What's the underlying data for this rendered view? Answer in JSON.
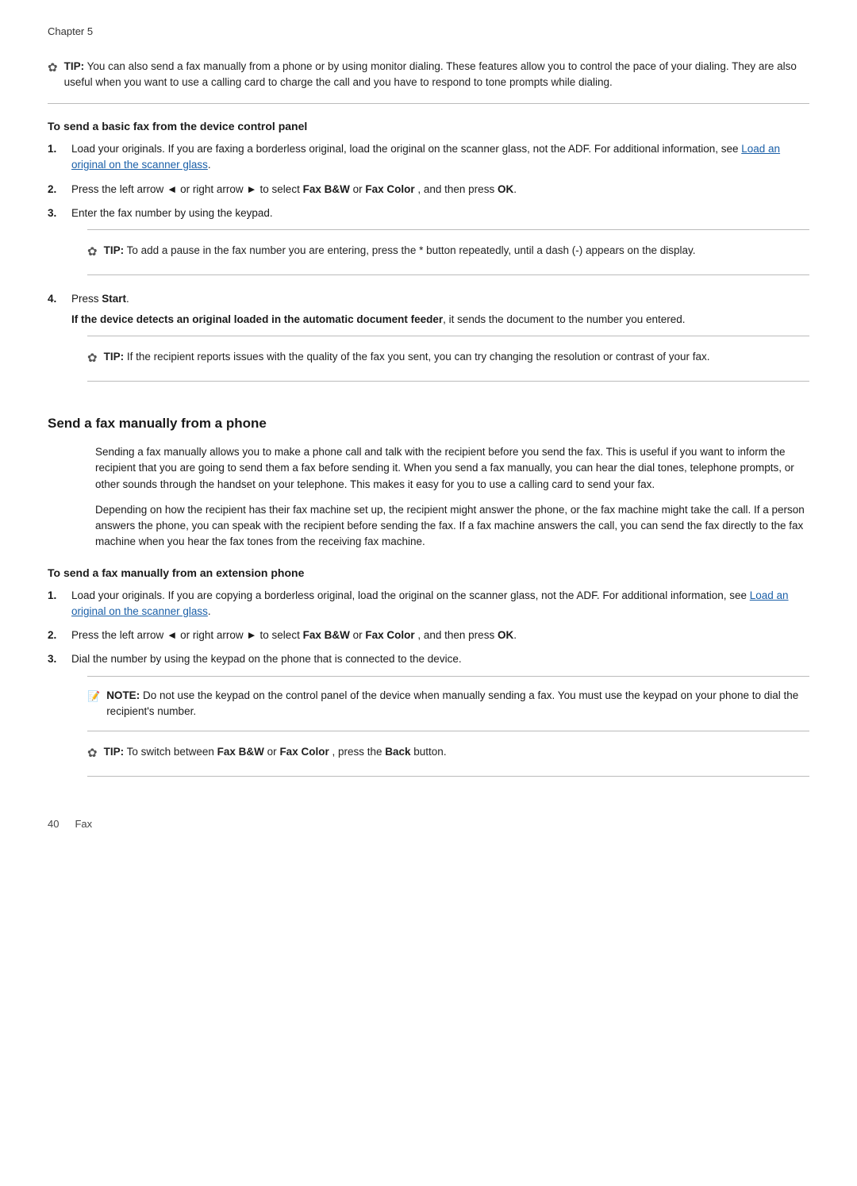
{
  "chapter": "Chapter 5",
  "footer": {
    "page_num": "40",
    "section": "Fax"
  },
  "tip1": {
    "label": "TIP:",
    "text": "You can also send a fax manually from a phone or by using monitor dialing. These features allow you to control the pace of your dialing. They are also useful when you want to use a calling card to charge the call and you have to respond to tone prompts while dialing."
  },
  "section1_heading": "To send a basic fax from the device control panel",
  "steps1": [
    {
      "num": "1.",
      "text_before": "Load your originals. If you are faxing a borderless original, load the original on the scanner glass, not the ADF. For additional information, see ",
      "link_text": "Load an original on the scanner glass",
      "text_after": ".",
      "link": true
    },
    {
      "num": "2.",
      "text_plain": "Press the left arrow ◄ or right arrow ► to select ",
      "bold1": "Fax B&W",
      "text_mid": " or ",
      "bold2": "Fax Color",
      "text_end": " , and then press ",
      "bold3": "OK",
      "text_final": ".",
      "has_bold": true,
      "link": false
    },
    {
      "num": "3.",
      "text_plain": "Enter the fax number by using the keypad.",
      "link": false
    }
  ],
  "tip2": {
    "label": "TIP:",
    "text": "To add a pause in the fax number you are entering, press the * button repeatedly, until a dash (-) appears on the display."
  },
  "step4": {
    "num": "4.",
    "bold_start": "Press ",
    "bold_word": "Start",
    "sub_bold": "If the device detects an original loaded in the automatic document feeder",
    "sub_text": ", it sends the document to the number you entered."
  },
  "tip3": {
    "label": "TIP:",
    "text": "If the recipient reports issues with the quality of the fax you sent, you can try changing the resolution or contrast of your fax."
  },
  "main_section_title": "Send a fax manually from a phone",
  "body_para1": "Sending a fax manually allows you to make a phone call and talk with the recipient before you send the fax. This is useful if you want to inform the recipient that you are going to send them a fax before sending it. When you send a fax manually, you can hear the dial tones, telephone prompts, or other sounds through the handset on your telephone. This makes it easy for you to use a calling card to send your fax.",
  "body_para2": "Depending on how the recipient has their fax machine set up, the recipient might answer the phone, or the fax machine might take the call. If a person answers the phone, you can speak with the recipient before sending the fax. If a fax machine answers the call, you can send the fax directly to the fax machine when you hear the fax tones from the receiving fax machine.",
  "section2_heading": "To send a fax manually from an extension phone",
  "steps2": [
    {
      "num": "1.",
      "text_before": "Load your originals. If you are copying a borderless original, load the original on the scanner glass, not the ADF. For additional information, see ",
      "link_text": "Load an original on the scanner glass",
      "text_after": ".",
      "link": true
    },
    {
      "num": "2.",
      "text_plain": "Press the left arrow ◄ or right arrow ► to select ",
      "bold1": "Fax B&W",
      "text_mid": " or ",
      "bold2": "Fax Color",
      "text_end": " , and then press ",
      "bold3": "OK",
      "text_final": ".",
      "has_bold": true,
      "link": false
    },
    {
      "num": "3.",
      "text_plain": "Dial the number by using the keypad on the phone that is connected to the device.",
      "link": false
    }
  ],
  "note1": {
    "label": "NOTE:",
    "text": "Do not use the keypad on the control panel of the device when manually sending a fax. You must use the keypad on your phone to dial the recipient's number."
  },
  "tip4": {
    "label": "TIP:",
    "text_before": "To switch between ",
    "bold1": "Fax B&W",
    "text_mid": " or ",
    "bold2": "Fax Color",
    "text_end": " , press the ",
    "bold3": "Back",
    "text_final": " button.",
    "has_bold": true
  }
}
